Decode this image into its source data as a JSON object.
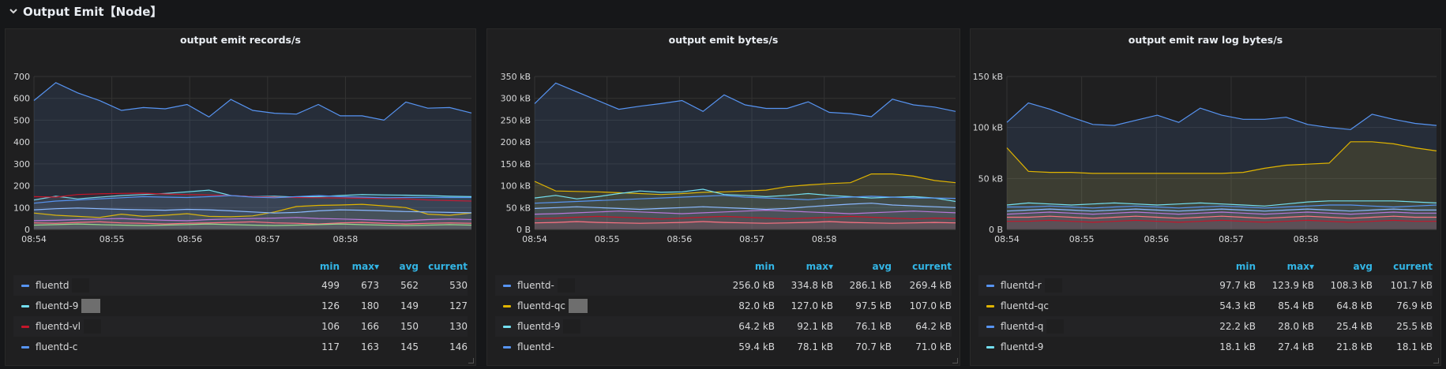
{
  "row": {
    "title": "Output Emit【Node】"
  },
  "panels": [
    {
      "title": "output emit records/s",
      "colors": {
        "bg": "#1f1f20"
      },
      "legend_headers": {
        "min": "min",
        "max": "max▾",
        "avg": "avg",
        "current": "current"
      },
      "legend": [
        {
          "name": "fluentd",
          "color": "#5794f2",
          "min": "499",
          "max": "673",
          "avg": "562",
          "current": "530",
          "redact": "dark"
        },
        {
          "name": "fluentd-9",
          "color": "#73dff0",
          "min": "126",
          "max": "180",
          "avg": "149",
          "current": "127",
          "redact": "gray"
        },
        {
          "name": "fluentd-vl",
          "color": "#c4162a",
          "min": "106",
          "max": "166",
          "avg": "150",
          "current": "130",
          "redact": "dark"
        },
        {
          "name": "fluentd-c",
          "color": "#5794f2",
          "min": "117",
          "max": "163",
          "avg": "145",
          "current": "146",
          "redact": "dark"
        }
      ]
    },
    {
      "title": "output emit bytes/s",
      "legend_headers": {
        "min": "min",
        "max": "max▾",
        "avg": "avg",
        "current": "current"
      },
      "legend": [
        {
          "name": "fluentd-",
          "color": "#5794f2",
          "min": "256.0 kB",
          "max": "334.8 kB",
          "avg": "286.1 kB",
          "current": "269.4 kB",
          "redact": "dark"
        },
        {
          "name": "fluentd-qc",
          "color": "#e0b400",
          "min": "82.0 kB",
          "max": "127.0 kB",
          "avg": "97.5 kB",
          "current": "107.0 kB",
          "redact": "gray"
        },
        {
          "name": "fluentd-9",
          "color": "#73dff0",
          "min": "64.2 kB",
          "max": "92.1 kB",
          "avg": "76.1 kB",
          "current": "64.2 kB",
          "redact": "dark"
        },
        {
          "name": "fluentd-",
          "color": "#5794f2",
          "min": "59.4 kB",
          "max": "78.1 kB",
          "avg": "70.7 kB",
          "current": "71.0 kB",
          "redact": "dark"
        }
      ]
    },
    {
      "title": "output emit raw log bytes/s",
      "legend_headers": {
        "min": "min",
        "max": "max▾",
        "avg": "avg",
        "current": "current"
      },
      "legend": [
        {
          "name": "fluentd-r",
          "color": "#5794f2",
          "min": "97.7 kB",
          "max": "123.9 kB",
          "avg": "108.3 kB",
          "current": "101.7 kB",
          "redact": "dark"
        },
        {
          "name": "fluentd-qc",
          "color": "#e0b400",
          "min": "54.3 kB",
          "max": "85.4 kB",
          "avg": "64.8 kB",
          "current": "76.9 kB",
          "redact": "dark"
        },
        {
          "name": "fluentd-q",
          "color": "#5794f2",
          "min": "22.2 kB",
          "max": "28.0 kB",
          "avg": "25.4 kB",
          "current": "25.5 kB",
          "redact": "dark"
        },
        {
          "name": "fluentd-9",
          "color": "#73dff0",
          "min": "18.1 kB",
          "max": "27.4 kB",
          "avg": "21.8 kB",
          "current": "18.1 kB",
          "redact": "dark"
        }
      ]
    }
  ],
  "chart_data": [
    {
      "type": "area",
      "title": "output emit records/s",
      "x": [
        "08:54",
        "",
        "",
        "",
        "",
        "08:55",
        "",
        "",
        "",
        "",
        "08:56",
        "",
        "",
        "",
        "",
        "08:57",
        "",
        "",
        "",
        "",
        "08:58",
        "",
        "",
        "",
        "",
        ""
      ],
      "xticks": [
        "08:54",
        "08:55",
        "08:56",
        "08:57",
        "08:58"
      ],
      "yticks": [
        "0",
        "100",
        "200",
        "300",
        "400",
        "500",
        "600",
        "700"
      ],
      "ylim": [
        0,
        700
      ],
      "grid": true,
      "series": [
        {
          "color": "#5794f2",
          "values": [
            590,
            672,
            625,
            590,
            545,
            558,
            552,
            572,
            515,
            595,
            545,
            532,
            528,
            572,
            520,
            520,
            500,
            583,
            555,
            558,
            533
          ]
        },
        {
          "color": "#73dff0",
          "values": [
            135,
            152,
            140,
            148,
            155,
            160,
            165,
            172,
            180,
            155,
            150,
            152,
            148,
            150,
            155,
            160,
            158,
            157,
            155,
            152,
            150
          ]
        },
        {
          "color": "#c4162a",
          "values": [
            150,
            148,
            160,
            163,
            165,
            166,
            162,
            160,
            158,
            155,
            150,
            148,
            146,
            145,
            144,
            143,
            142,
            140,
            135,
            132,
            130
          ]
        },
        {
          "color": "#5794f2",
          "values": [
            120,
            130,
            135,
            140,
            145,
            150,
            148,
            146,
            150,
            155,
            148,
            145,
            150,
            155,
            150,
            148,
            145,
            146,
            147,
            146,
            146
          ]
        },
        {
          "color": "#e0b400",
          "values": [
            75,
            65,
            60,
            55,
            70,
            60,
            65,
            72,
            60,
            58,
            62,
            80,
            105,
            110,
            112,
            115,
            108,
            100,
            70,
            65,
            75
          ]
        },
        {
          "color": "#8ab8ff",
          "values": [
            90,
            95,
            98,
            95,
            92,
            90,
            88,
            92,
            90,
            85,
            80,
            75,
            78,
            85,
            90,
            88,
            85,
            82,
            80,
            78,
            76
          ]
        },
        {
          "color": "#b877d9",
          "values": [
            40,
            42,
            45,
            48,
            50,
            45,
            42,
            40,
            45,
            48,
            50,
            52,
            55,
            50,
            48,
            45,
            42,
            40,
            45,
            48,
            45
          ]
        },
        {
          "color": "#ff7383",
          "values": [
            30,
            28,
            32,
            35,
            30,
            28,
            25,
            28,
            30,
            32,
            35,
            30,
            28,
            25,
            30,
            32,
            28,
            25,
            28,
            30,
            28
          ]
        },
        {
          "color": "#96d98d",
          "values": [
            20,
            22,
            25,
            22,
            20,
            18,
            20,
            22,
            25,
            22,
            20,
            18,
            20,
            22,
            25,
            22,
            20,
            18,
            20,
            22,
            20
          ]
        }
      ]
    },
    {
      "type": "area",
      "title": "output emit bytes/s",
      "xticks": [
        "08:54",
        "08:55",
        "08:56",
        "08:57",
        "08:58"
      ],
      "yticks": [
        "0 B",
        "50 kB",
        "100 kB",
        "150 kB",
        "200 kB",
        "250 kB",
        "300 kB",
        "350 kB"
      ],
      "ylim": [
        0,
        350
      ],
      "grid": true,
      "series": [
        {
          "color": "#5794f2",
          "values": [
            288,
            335,
            315,
            295,
            275,
            282,
            288,
            295,
            270,
            308,
            285,
            277,
            277,
            292,
            268,
            265,
            258,
            298,
            285,
            280,
            270
          ]
        },
        {
          "color": "#e0b400",
          "values": [
            110,
            88,
            87,
            86,
            84,
            82,
            80,
            82,
            85,
            86,
            88,
            90,
            98,
            102,
            105,
            107,
            127,
            127,
            122,
            112,
            107
          ]
        },
        {
          "color": "#73dff0",
          "values": [
            72,
            78,
            70,
            75,
            82,
            88,
            85,
            86,
            92,
            80,
            78,
            75,
            78,
            82,
            78,
            75,
            72,
            74,
            75,
            72,
            64
          ]
        },
        {
          "color": "#5794f2",
          "values": [
            60,
            62,
            64,
            66,
            68,
            70,
            72,
            74,
            76,
            78,
            74,
            72,
            70,
            68,
            72,
            74,
            76,
            74,
            72,
            72,
            71
          ]
        },
        {
          "color": "#8ab8ff",
          "values": [
            48,
            50,
            52,
            50,
            48,
            46,
            48,
            50,
            52,
            50,
            48,
            46,
            48,
            52,
            55,
            58,
            60,
            56,
            54,
            52,
            50
          ]
        },
        {
          "color": "#b877d9",
          "values": [
            35,
            36,
            38,
            40,
            42,
            40,
            38,
            36,
            38,
            40,
            42,
            44,
            42,
            40,
            38,
            36,
            38,
            40,
            42,
            40,
            38
          ]
        },
        {
          "color": "#c4162a",
          "values": [
            25,
            26,
            28,
            30,
            28,
            26,
            24,
            26,
            28,
            30,
            28,
            26,
            24,
            26,
            28,
            30,
            28,
            26,
            24,
            26,
            25
          ]
        },
        {
          "color": "#ff7383",
          "values": [
            15,
            16,
            18,
            16,
            15,
            14,
            15,
            16,
            18,
            16,
            15,
            14,
            15,
            16,
            18,
            16,
            15,
            14,
            15,
            16,
            15
          ]
        }
      ]
    },
    {
      "type": "area",
      "title": "output emit raw log bytes/s",
      "xticks": [
        "08:54",
        "08:55",
        "08:56",
        "08:57",
        "08:58"
      ],
      "yticks": [
        "0 B",
        "50 kB",
        "100 kB",
        "150 kB"
      ],
      "ylim": [
        0,
        150
      ],
      "grid": true,
      "series": [
        {
          "color": "#5794f2",
          "values": [
            105,
            124,
            118,
            110,
            103,
            102,
            107,
            112,
            105,
            119,
            112,
            108,
            108,
            110,
            103,
            100,
            98,
            113,
            108,
            104,
            102
          ]
        },
        {
          "color": "#e0b400",
          "values": [
            80,
            57,
            56,
            56,
            55,
            55,
            55,
            55,
            55,
            55,
            55,
            56,
            60,
            63,
            64,
            65,
            86,
            86,
            84,
            80,
            77
          ]
        },
        {
          "color": "#73dff0",
          "values": [
            24,
            26,
            25,
            24,
            25,
            26,
            25,
            24,
            25,
            26,
            25,
            24,
            23,
            25,
            27,
            28,
            28,
            28,
            28,
            27,
            26
          ]
        },
        {
          "color": "#5794f2",
          "values": [
            22,
            22,
            23,
            22,
            21,
            22,
            23,
            22,
            21,
            22,
            23,
            22,
            21,
            22,
            23,
            24,
            24,
            23,
            22,
            23,
            24
          ]
        },
        {
          "color": "#8ab8ff",
          "values": [
            18,
            19,
            20,
            19,
            18,
            19,
            20,
            19,
            18,
            19,
            20,
            19,
            18,
            19,
            20,
            19,
            18,
            19,
            20,
            19,
            19
          ]
        },
        {
          "color": "#b877d9",
          "values": [
            15,
            16,
            17,
            16,
            15,
            16,
            17,
            16,
            15,
            16,
            17,
            16,
            15,
            16,
            17,
            16,
            15,
            16,
            17,
            16,
            16
          ]
        },
        {
          "color": "#ff7383",
          "values": [
            12,
            12,
            13,
            12,
            11,
            12,
            13,
            12,
            11,
            12,
            13,
            12,
            11,
            12,
            13,
            12,
            11,
            12,
            13,
            12,
            12
          ]
        },
        {
          "color": "#c4162a",
          "values": [
            8,
            8,
            9,
            8,
            7,
            8,
            9,
            8,
            7,
            8,
            9,
            8,
            7,
            8,
            9,
            8,
            7,
            8,
            9,
            8,
            8
          ]
        }
      ]
    }
  ]
}
